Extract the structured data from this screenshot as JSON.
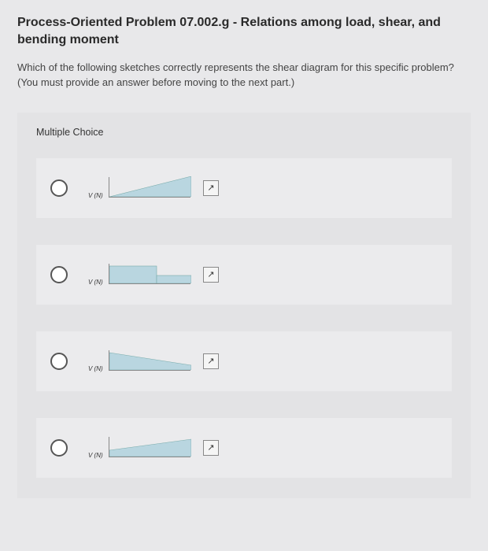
{
  "title": "Process-Oriented Problem 07.002.g - Relations among load, shear, and bending moment",
  "prompt": "Which of the following sketches correctly represents the shear diagram for this specific problem? (You must provide an answer before moving to the next part.)",
  "mc_label": "Multiple Choice",
  "axis_label": "V (N)",
  "expand_glyph": "↗",
  "options": [
    {
      "id": "a"
    },
    {
      "id": "b"
    },
    {
      "id": "c"
    },
    {
      "id": "d"
    }
  ]
}
